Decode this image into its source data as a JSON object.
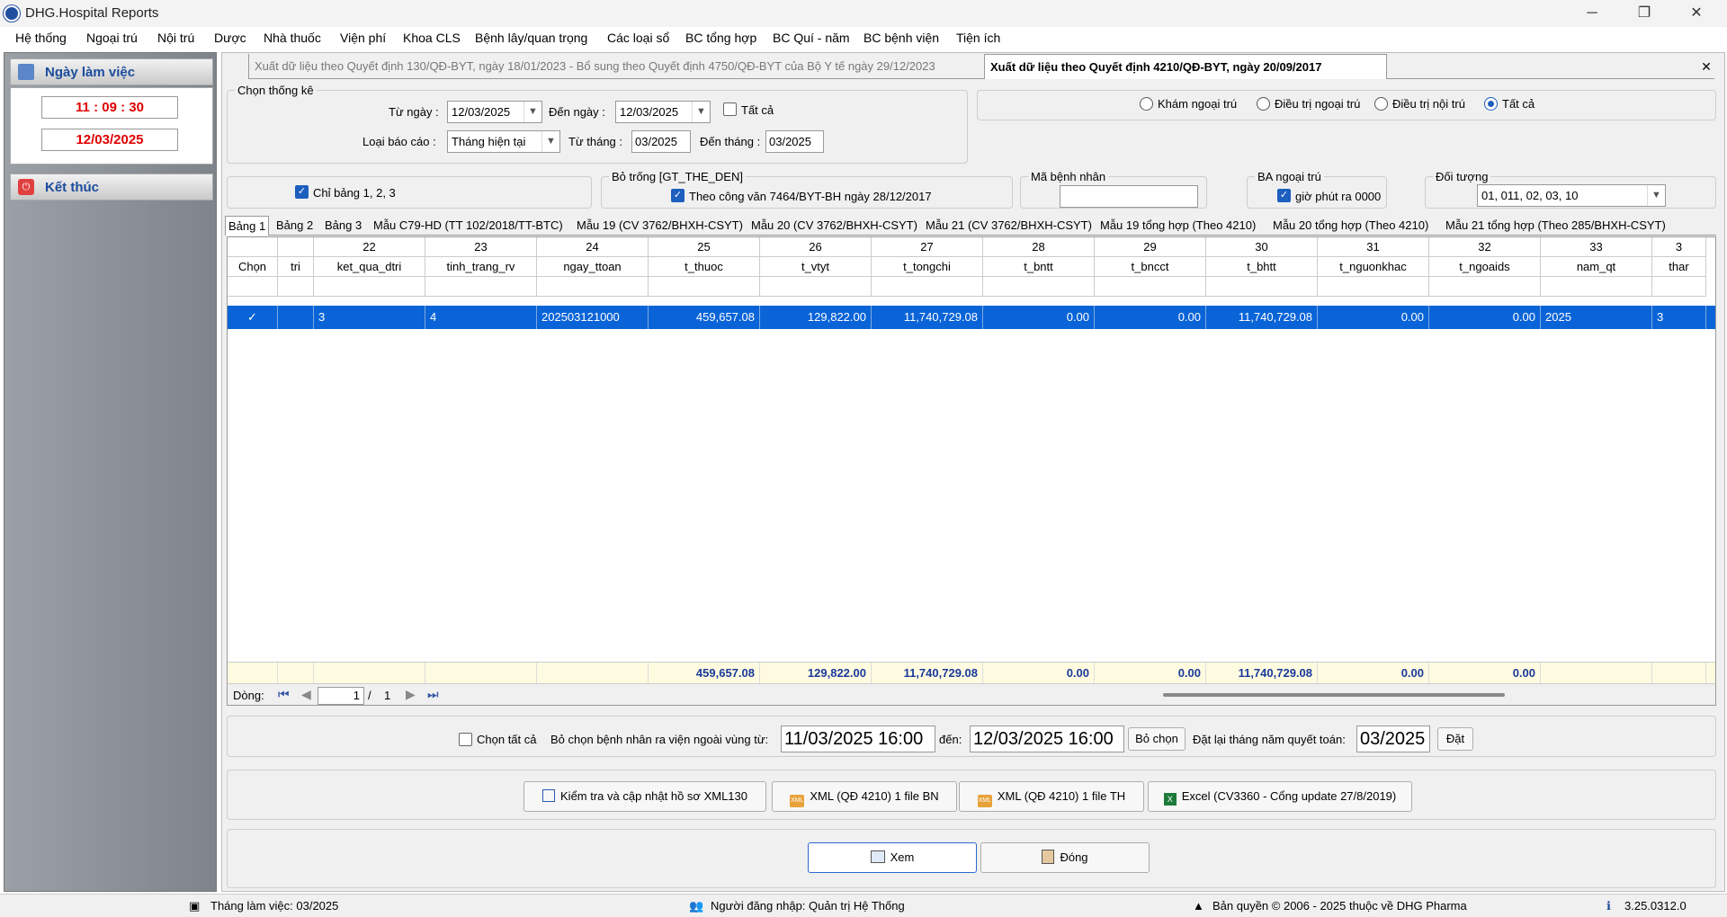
{
  "window": {
    "title": "DHG.Hospital Reports"
  },
  "menu": [
    "Hệ thống",
    "Ngoại trú",
    "Nội trú",
    "Dược",
    "Nhà thuốc",
    "Viện phí",
    "Khoa CLS",
    "Bệnh lây/quan trọng",
    "Các loại sổ",
    "BC tổng hợp",
    "BC Quí - năm",
    "BC bệnh viện",
    "Tiện ích"
  ],
  "left": {
    "work_day_title": "Ngày làm việc",
    "time": "11 : 09 : 30",
    "date": "12/03/2025",
    "exit_label": "Kết thúc"
  },
  "top_tabs": [
    "Xuất dữ liệu theo Quyết định 130/QĐ-BYT, ngày 18/01/2023 - Bổ sung theo Quyết định 4750/QĐ-BYT của Bộ Y tế ngày 29/12/2023",
    "Xuất dữ liệu theo Quyết định 4210/QĐ-BYT, ngày 20/09/2017"
  ],
  "filters": {
    "group_title": "Chọn thống kê",
    "from_date_label": "Từ ngày :",
    "from_date": "12/03/2025",
    "to_date_label": "Đến ngày :",
    "to_date": "12/03/2025",
    "all_label": "Tất cả",
    "report_type_label": "Loại báo cáo :",
    "report_type": "Tháng hiện tại",
    "from_month_label": "Từ tháng :",
    "from_month": "03/2025",
    "to_month_label": "Đến tháng :",
    "to_month": "03/2025",
    "radios": [
      "Khám ngoại trú",
      "Điều trị ngoại trú",
      "Điều trị nội trú",
      "Tất cả"
    ],
    "only_tables_label": "Chỉ bảng 1, 2, 3",
    "blank_card_title": "Bỏ trống [GT_THE_DEN]",
    "blank_card_label": "Theo công văn 7464/BYT-BH ngày 28/12/2017",
    "patient_code_title": "Mã bệnh nhân",
    "outpatient_title": "BA ngoại trú",
    "outpatient_label": "giờ phút ra 0000",
    "target_title": "Đối tượng",
    "target_value": "01, 011, 02, 03, 10"
  },
  "sub_tabs": [
    "Bảng 1",
    "Bảng 2",
    "Bảng 3",
    "Mẫu C79-HD (TT 102/2018/TT-BTC)",
    "Mẫu 19 (CV 3762/BHXH-CSYT)",
    "Mẫu 20 (CV 3762/BHXH-CSYT)",
    "Mẫu 21 (CV 3762/BHXH-CSYT)",
    "Mẫu 19 tổng hợp (Theo 4210)",
    "Mẫu 20 tổng hợp (Theo 4210)",
    "Mẫu 21 tổng hợp (Theo 285/BHXH-CSYT)"
  ],
  "grid": {
    "col_numbers": [
      "",
      "",
      "22",
      "23",
      "24",
      "25",
      "26",
      "27",
      "28",
      "29",
      "30",
      "31",
      "32",
      "33",
      "3"
    ],
    "col_names": [
      "Chọn",
      "tri",
      "ket_qua_dtri",
      "tinh_trang_rv",
      "ngay_ttoan",
      "t_thuoc",
      "t_vtyt",
      "t_tongchi",
      "t_bntt",
      "t_bncct",
      "t_bhtt",
      "t_nguonkhac",
      "t_ngoaids",
      "nam_qt",
      "thar"
    ],
    "row": [
      "✓",
      "",
      "3",
      "4",
      "202503121000",
      "459,657.08",
      "129,822.00",
      "11,740,729.08",
      "0.00",
      "0.00",
      "11,740,729.08",
      "0.00",
      "0.00",
      "2025",
      "3"
    ],
    "footer": [
      "",
      "",
      "",
      "",
      "",
      "459,657.08",
      "129,822.00",
      "11,740,729.08",
      "0.00",
      "0.00",
      "11,740,729.08",
      "0.00",
      "0.00",
      "",
      ""
    ]
  },
  "pager": {
    "label": "Dòng:",
    "current": "1",
    "sep": "/",
    "total": "1"
  },
  "exclude": {
    "select_all_label": "Chọn tất cả",
    "range_label": "Bỏ chọn bệnh nhân ra viện ngoài vùng từ:",
    "from": "11/03/2025 16:00",
    "to_label": "đến:",
    "to": "12/03/2025 16:00",
    "unselect_btn": "Bỏ chọn",
    "reset_label": "Đặt lại tháng năm quyết toán:",
    "month": "03/2025",
    "set_btn": "Đặt"
  },
  "actions": {
    "check": "Kiểm tra và cập nhật hồ sơ XML130",
    "xml_bn": "XML (QĐ 4210) 1 file BN",
    "xml_th": "XML (QĐ 4210) 1 file TH",
    "excel": "Excel (CV3360 - Cổng update 27/8/2019)",
    "view": "Xem",
    "close": "Đóng"
  },
  "status": {
    "month": "Tháng làm việc: 03/2025",
    "user": "Người đăng nhập: Quản trị Hệ Thống",
    "copyright": "Bản quyền © 2006 - 2025 thuộc về DHG Pharma",
    "version": "3.25.0312.0"
  },
  "colors": {
    "selection": "#0a64d8",
    "accent": "#1b4c9c",
    "time_red": "#e00000"
  }
}
